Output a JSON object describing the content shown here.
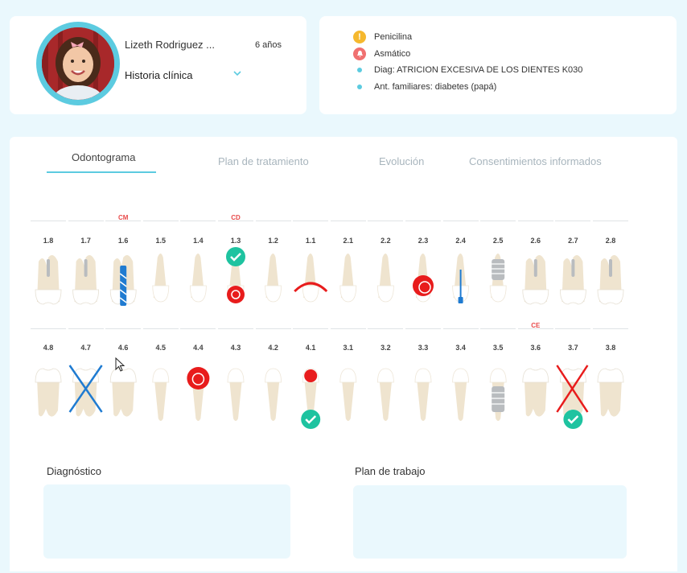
{
  "patient": {
    "name": "Lizeth Rodriguez ...",
    "age": "6 años",
    "history_label": "Historia clínica"
  },
  "alerts": [
    {
      "icon": "warning-icon",
      "color": "#f5b82e",
      "text": "Penicilina"
    },
    {
      "icon": "bell-icon",
      "color": "#f07070",
      "text": "Asmático"
    },
    {
      "icon": "bullet-dot",
      "color": "#5ccbe0",
      "text": "Diag: ATRICION EXCESIVA DE LOS DIENTES K030"
    },
    {
      "icon": "bullet-dot",
      "color": "#5ccbe0",
      "text": "Ant. familiares: diabetes (papá)"
    }
  ],
  "tabs": [
    {
      "label": "Odontograma",
      "active": true
    },
    {
      "label": "Plan de tratamiento",
      "active": false
    },
    {
      "label": "Evolución",
      "active": false
    },
    {
      "label": "Consentimientos informados",
      "active": false
    }
  ],
  "odontogram": {
    "upper_teeth": [
      "1.8",
      "1.7",
      "1.6",
      "1.5",
      "1.4",
      "1.3",
      "1.2",
      "1.1",
      "2.1",
      "2.2",
      "2.3",
      "2.4",
      "2.5",
      "2.6",
      "2.7",
      "2.8"
    ],
    "lower_teeth": [
      "4.8",
      "4.7",
      "4.6",
      "4.5",
      "4.4",
      "4.3",
      "4.2",
      "4.1",
      "3.1",
      "3.2",
      "3.3",
      "3.4",
      "3.5",
      "3.6",
      "3.7",
      "3.8"
    ],
    "upper_labels": {
      "1.6": "CM",
      "1.3": "CD"
    },
    "lower_labels": {
      "3.6": "CE"
    },
    "colors": {
      "tooth": "#efe4cf",
      "crown": "#ffffff",
      "red": "#e81c1c",
      "blue": "#1f7bd1",
      "gray": "#b9bcbf",
      "check": "#1ec3a0"
    }
  },
  "sections": {
    "diagnosis": "Diagnóstico",
    "work_plan": "Plan de trabajo"
  }
}
